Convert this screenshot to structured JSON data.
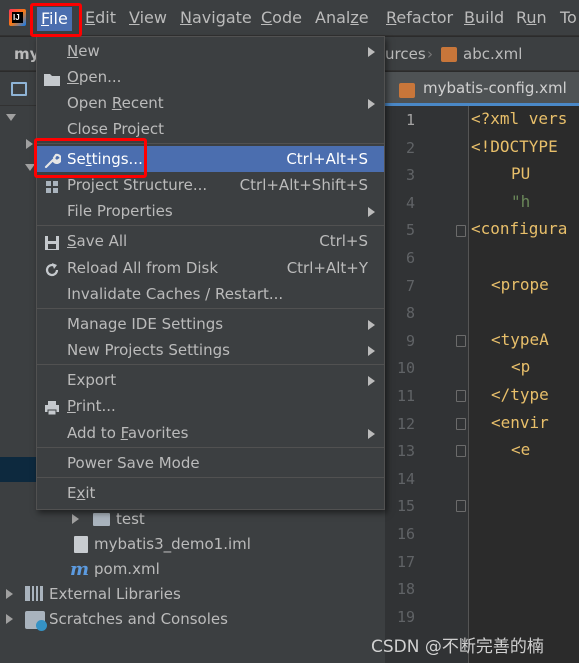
{
  "menubar": {
    "items": [
      {
        "label": "File",
        "mnemonic": "F",
        "rest": "ile"
      },
      {
        "label": "Edit",
        "mnemonic": "E",
        "rest": "dit"
      },
      {
        "label": "View",
        "mnemonic": "V",
        "rest": "iew"
      },
      {
        "label": "Navigate",
        "mnemonic": "N",
        "rest": "avigate"
      },
      {
        "label": "Code",
        "mnemonic": "C",
        "rest": "ode"
      },
      {
        "label": "Analyze",
        "mnemonic": "z",
        "pre": "Anal",
        "rest": "e"
      },
      {
        "label": "Refactor",
        "mnemonic": "R",
        "rest": "efactor"
      },
      {
        "label": "Build",
        "mnemonic": "B",
        "rest": "uild"
      },
      {
        "label": "Run",
        "mnemonic": "u",
        "pre": "R",
        "rest": "n"
      },
      {
        "label": "To"
      }
    ]
  },
  "navbar": {
    "project_prefix": "my",
    "crumb_resources": "urces",
    "crumb_file": "abc.xml"
  },
  "editor": {
    "tab_label": "mybatis-config.xml",
    "line_numbers": [
      "1",
      "2",
      "3",
      "4",
      "5",
      "6",
      "7",
      "8",
      "9",
      "10",
      "11",
      "12",
      "13",
      "14",
      "15",
      "16",
      "17",
      "18",
      "19"
    ],
    "code_lines": [
      {
        "line": 1,
        "text": "<?xml vers"
      },
      {
        "line": 2,
        "text": "<!DOCTYPE "
      },
      {
        "line": 3,
        "text": "PU"
      },
      {
        "line": 4,
        "text": "\"h"
      },
      {
        "line": 5,
        "text": "<configura"
      },
      {
        "line": 7,
        "text": "<prope"
      },
      {
        "line": 9,
        "text": "<typeA"
      },
      {
        "line": 10,
        "text": "<p"
      },
      {
        "line": 11,
        "text": "</type"
      },
      {
        "line": 12,
        "text": "<envir"
      },
      {
        "line": 13,
        "text": "<e"
      }
    ]
  },
  "file_menu": {
    "items": [
      {
        "label": "New",
        "mnemonic": "N",
        "has_submenu": true,
        "icon": ""
      },
      {
        "label": "Open...",
        "mnemonic": "O",
        "icon": "folder-open-icon"
      },
      {
        "label": "Open Recent",
        "mnemonic": "R",
        "has_submenu": true
      },
      {
        "label": "Close Project",
        "mnemonic": "j"
      },
      {
        "label": "Settings...",
        "mnemonic": "t",
        "shortcut": "Ctrl+Alt+S",
        "icon": "wrench-icon",
        "highlighted": true
      },
      {
        "label": "Project Structure...",
        "shortcut": "Ctrl+Alt+Shift+S"
      },
      {
        "label": "File Properties",
        "has_submenu": true
      },
      {
        "label": "Save All",
        "mnemonic": "S",
        "shortcut": "Ctrl+S",
        "icon": "save-icon"
      },
      {
        "label": "Reload All from Disk",
        "shortcut": "Ctrl+Alt+Y",
        "icon": "reload-icon"
      },
      {
        "label": "Invalidate Caches / Restart..."
      },
      {
        "label": "Manage IDE Settings",
        "has_submenu": true
      },
      {
        "label": "New Projects Settings",
        "has_submenu": true
      },
      {
        "label": "Export",
        "has_submenu": true
      },
      {
        "label": "Print...",
        "mnemonic": "P",
        "icon": "print-icon"
      },
      {
        "label": "Add to Favorites",
        "mnemonic": "F",
        "has_submenu": true
      },
      {
        "label": "Power Save Mode"
      },
      {
        "label": "Exit",
        "mnemonic": "x"
      }
    ]
  },
  "project_tree": {
    "items": [
      {
        "label": "test",
        "icon": "folder-icon"
      },
      {
        "label": "mybatis3_demo1.iml",
        "icon": "module-file-icon"
      },
      {
        "label": "pom.xml",
        "icon": "maven-icon"
      },
      {
        "label": "External Libraries",
        "icon": "libraries-icon"
      },
      {
        "label": "Scratches and Consoles",
        "icon": "scratches-icon"
      }
    ]
  },
  "watermark": "CSDN @不断完善的楠",
  "colors": {
    "menu_bg": "#3c3f41",
    "highlight": "#4b6eaf",
    "editor_bg": "#2b2b2b",
    "annotation": "#ff0000"
  }
}
